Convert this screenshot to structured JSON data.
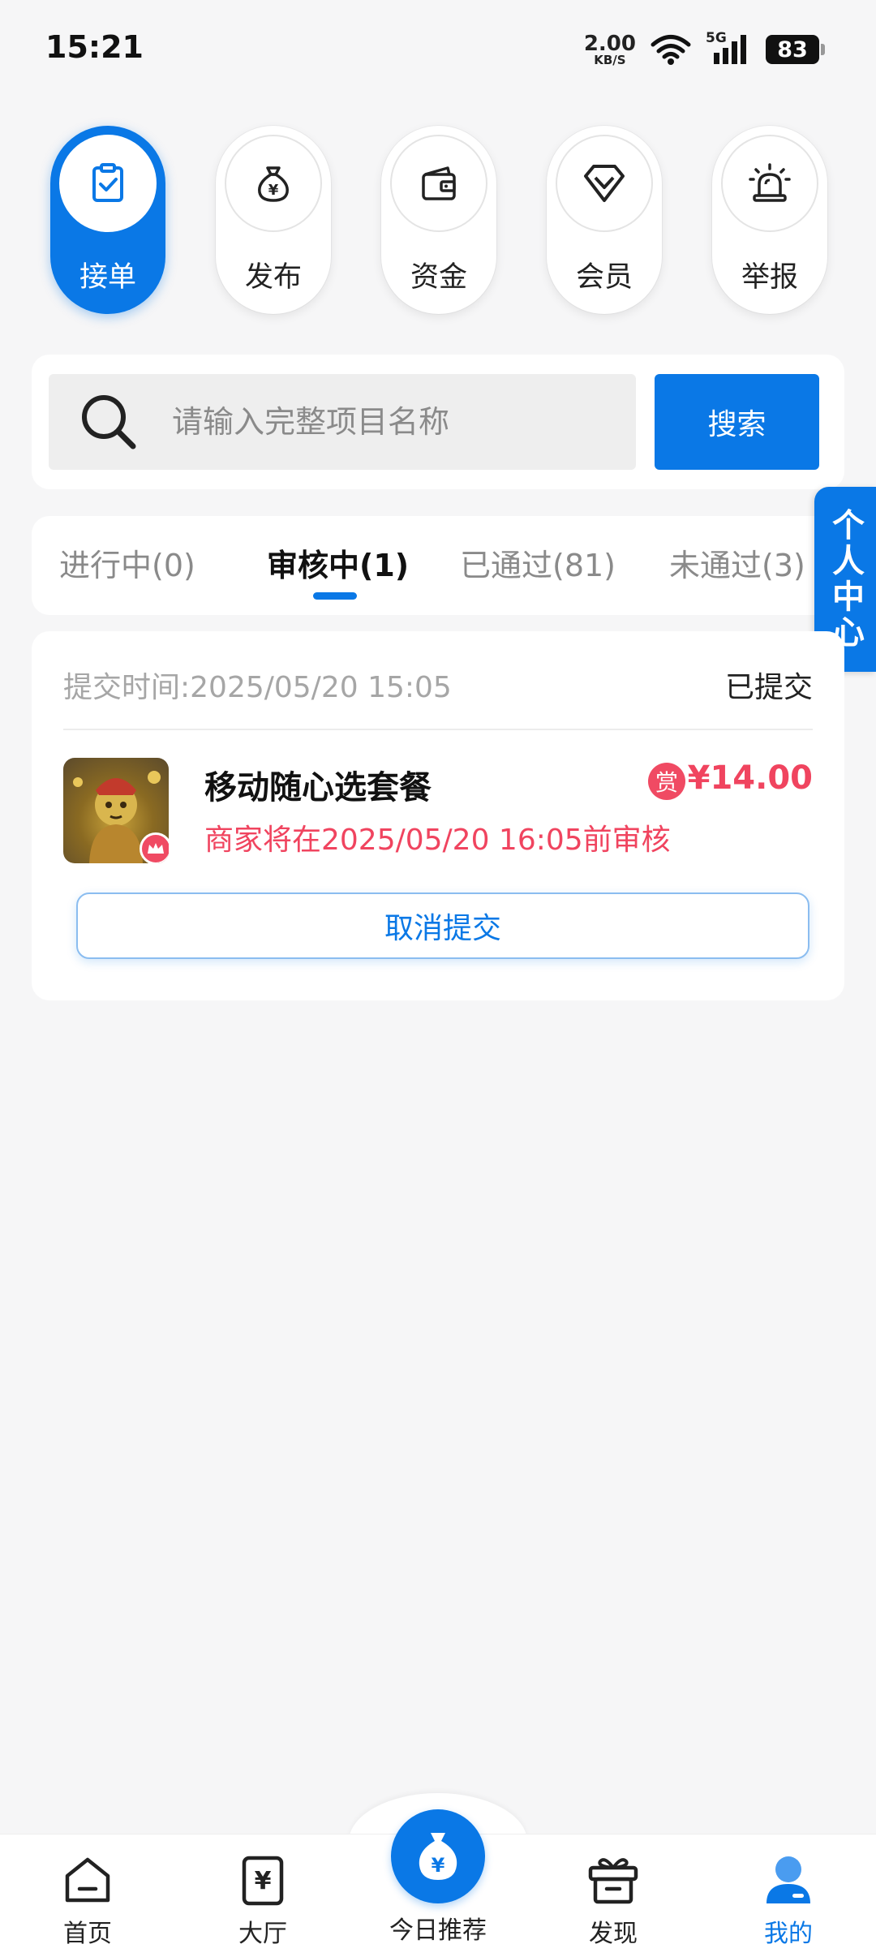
{
  "status_bar": {
    "time": "15:21",
    "net_speed": "2.00",
    "net_unit": "KB/S",
    "network": "5G",
    "battery": "83"
  },
  "top_nav": [
    {
      "label": "接单",
      "icon": "clipboard-check-icon",
      "active": true
    },
    {
      "label": "发布",
      "icon": "money-bag-icon",
      "active": false
    },
    {
      "label": "资金",
      "icon": "wallet-icon",
      "active": false
    },
    {
      "label": "会员",
      "icon": "diamond-icon",
      "active": false
    },
    {
      "label": "举报",
      "icon": "alarm-icon",
      "active": false
    }
  ],
  "search": {
    "placeholder": "请输入完整项目名称",
    "button": "搜索"
  },
  "tabs": [
    {
      "label": "进行中(0)",
      "active": false
    },
    {
      "label": "审核中(1)",
      "active": true
    },
    {
      "label": "已通过(81)",
      "active": false
    },
    {
      "label": "未通过(3)",
      "active": false
    }
  ],
  "side_tab": {
    "label": "个人中心"
  },
  "task": {
    "submit_time": "提交时间:2025/05/20 15:05",
    "status": "已提交",
    "title": "移动随心选套餐",
    "reward_icon": "赏",
    "reward_amount": "¥14.00",
    "review_deadline": "商家将在2025/05/20 16:05前审核",
    "cancel_label": "取消提交"
  },
  "bottom_nav": [
    {
      "label": "首页",
      "icon": "home-icon"
    },
    {
      "label": "大厅",
      "icon": "yen-receipt-icon"
    },
    {
      "label": "今日推荐",
      "icon": "money-bag-icon"
    },
    {
      "label": "发现",
      "icon": "gift-box-icon"
    },
    {
      "label": "我的",
      "icon": "user-icon",
      "active": true
    }
  ],
  "colors": {
    "accent": "#0a78e6",
    "reward": "#f0445f",
    "background": "#f6f6f7"
  }
}
